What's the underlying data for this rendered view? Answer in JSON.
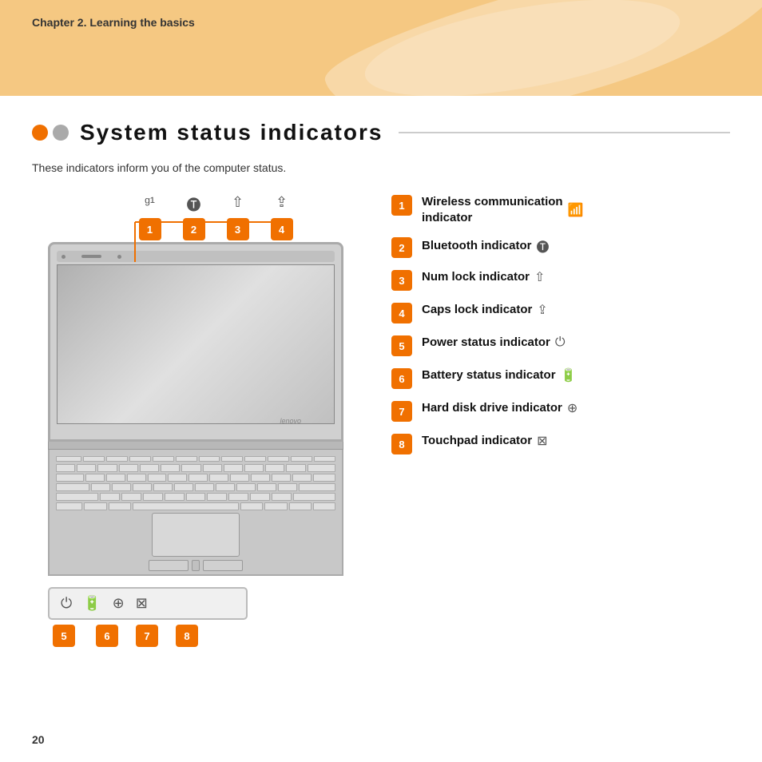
{
  "header": {
    "chapter": "Chapter 2. Learning the basics"
  },
  "section": {
    "title": "System  status  indicators",
    "subtitle": "These indicators inform you of the computer status."
  },
  "top_indicators": [
    {
      "badge": "1",
      "icon": "📶"
    },
    {
      "badge": "2",
      "icon": "🔵"
    },
    {
      "badge": "3",
      "icon": "⇧"
    },
    {
      "badge": "4",
      "icon": "⇪"
    }
  ],
  "bottom_indicators": [
    {
      "badge": "5",
      "icon": "⏻"
    },
    {
      "badge": "6",
      "icon": "🔋"
    },
    {
      "badge": "7",
      "icon": "💾"
    },
    {
      "badge": "8",
      "icon": "⊠"
    }
  ],
  "items": [
    {
      "badge": "1",
      "text": "Wireless communication\nindicator",
      "icon": "📶"
    },
    {
      "badge": "2",
      "text": "Bluetooth indicator",
      "icon": "🔵"
    },
    {
      "badge": "3",
      "text": "Num lock indicator",
      "icon": "⇧"
    },
    {
      "badge": "4",
      "text": "Caps lock indicator",
      "icon": "⇪"
    },
    {
      "badge": "5",
      "text": "Power status indicator",
      "icon": "⏻"
    },
    {
      "badge": "6",
      "text": "Battery status indicator",
      "icon": "🔋"
    },
    {
      "badge": "7",
      "text": "Hard disk drive indicator",
      "icon": "💾"
    },
    {
      "badge": "8",
      "text": "Touchpad indicator",
      "icon": "⊠"
    }
  ],
  "page_number": "20"
}
